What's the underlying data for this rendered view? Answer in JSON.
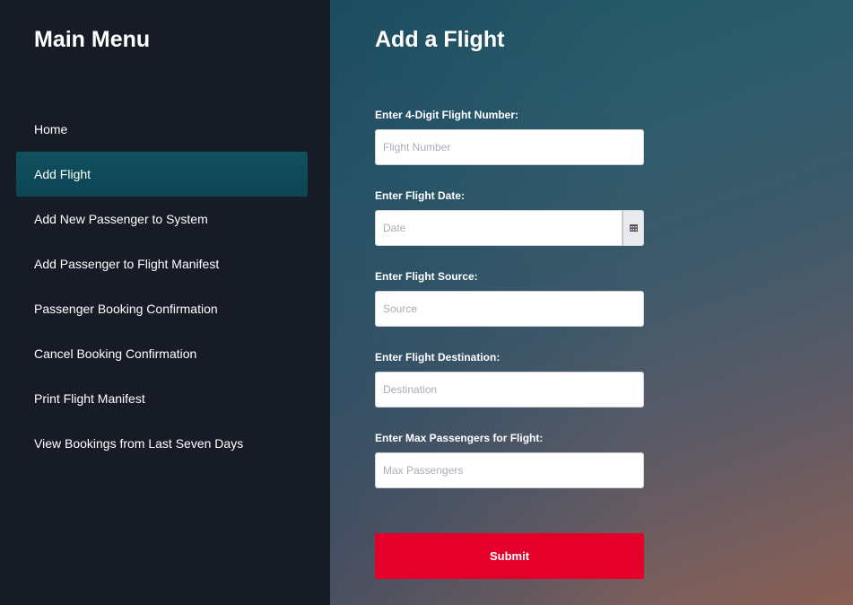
{
  "sidebar": {
    "title": "Main Menu",
    "items": [
      {
        "label": "Home"
      },
      {
        "label": "Add Flight",
        "active": true
      },
      {
        "label": "Add New Passenger to System"
      },
      {
        "label": "Add Passenger to Flight Manifest"
      },
      {
        "label": "Passenger Booking Confirmation"
      },
      {
        "label": "Cancel Booking Confirmation"
      },
      {
        "label": "Print Flight Manifest"
      },
      {
        "label": "View Bookings from Last Seven Days"
      }
    ]
  },
  "main": {
    "title": "Add a Flight",
    "form": {
      "flight_number": {
        "label": "Enter 4-Digit Flight Number:",
        "placeholder": "Flight Number",
        "value": ""
      },
      "flight_date": {
        "label": "Enter Flight Date:",
        "placeholder": "Date",
        "value": "",
        "icon": "calendar-icon"
      },
      "source": {
        "label": "Enter Flight Source:",
        "placeholder": "Source",
        "value": ""
      },
      "destination": {
        "label": "Enter Flight Destination:",
        "placeholder": "Destination",
        "value": ""
      },
      "max_passengers": {
        "label": "Enter Max Passengers for Flight:",
        "placeholder": "Max Passengers",
        "value": ""
      },
      "submit_label": "Submit"
    }
  },
  "colors": {
    "sidebar_bg": "#171b26",
    "active_item_bg": "#0c4554",
    "submit_bg": "#e4002b",
    "text": "#ffffff"
  }
}
